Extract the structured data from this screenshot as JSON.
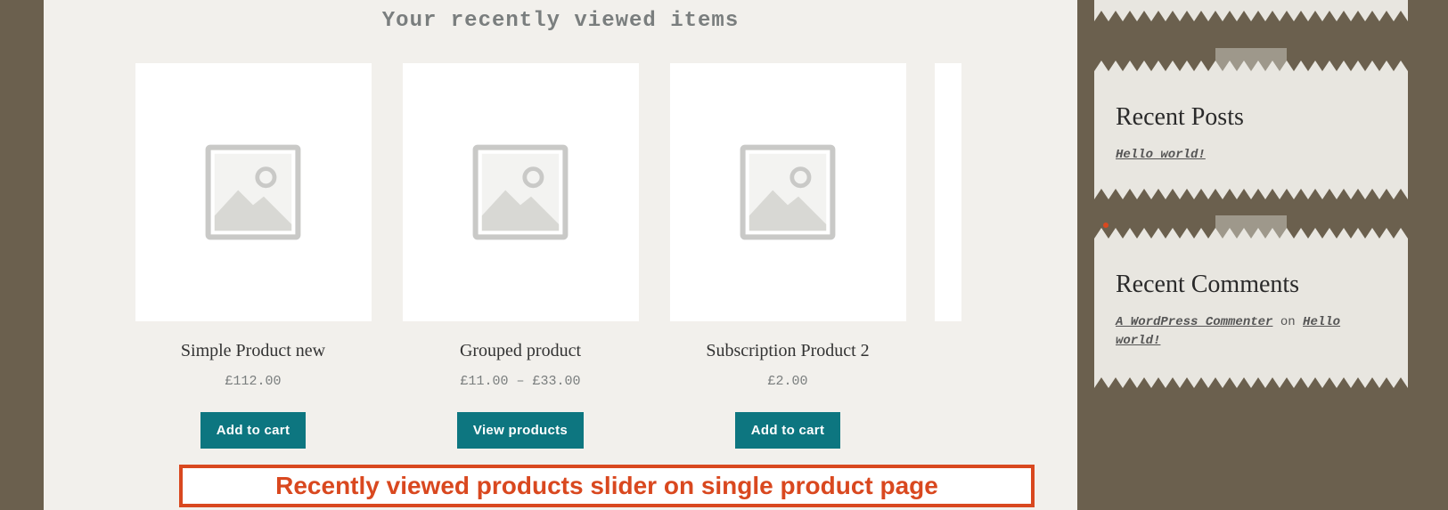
{
  "section_title": "Your recently viewed items",
  "products": [
    {
      "title": "Simple Product new",
      "price": "£112.00",
      "button": "Add to cart"
    },
    {
      "title": "Grouped product",
      "price": "£11.00 – £33.00",
      "button": "View products"
    },
    {
      "title": "Subscription Product 2",
      "price": "£2.00",
      "button": "Add to cart"
    }
  ],
  "caption": "Recently viewed products slider on single product page",
  "sidebar": {
    "recent_posts": {
      "heading": "Recent Posts",
      "items": [
        "Hello world!"
      ]
    },
    "recent_comments": {
      "heading": "Recent Comments",
      "author": "A WordPress Commenter",
      "on_text": " on ",
      "post": "Hello world!"
    }
  }
}
